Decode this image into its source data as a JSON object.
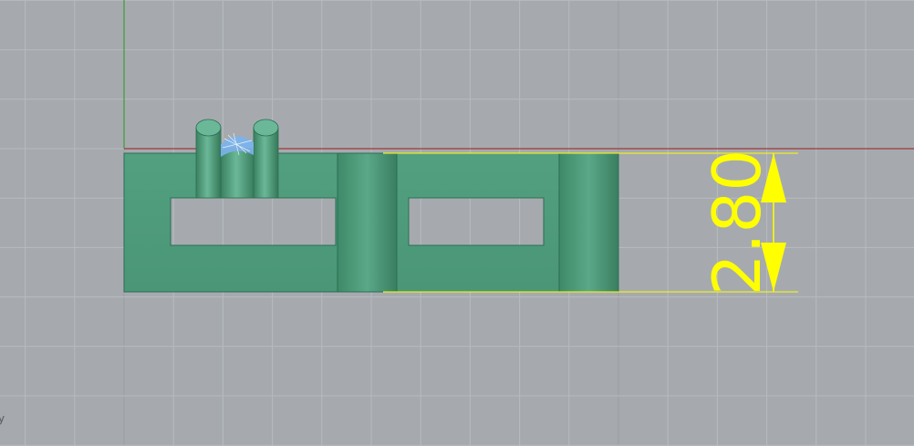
{
  "viewport": {
    "background": "#a6aaae",
    "grid_color": "#b7bbbf",
    "major_grid_color": "#9a9ea2",
    "x_axis_color": "#9e3a3a",
    "y_axis_color": "#3a9e3a",
    "axis_indicator": "y"
  },
  "model": {
    "fill": "#4a9a78",
    "dark_fill": "#3a8060",
    "edge": "#2b6e52",
    "selection_mesh_color": "#7ab4ee"
  },
  "dimension": {
    "value": "2.80",
    "color": "#ffff00"
  }
}
